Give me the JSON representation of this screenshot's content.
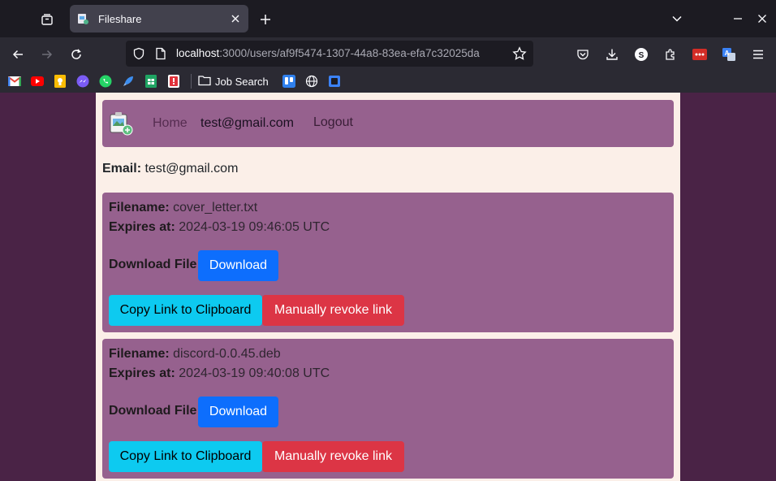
{
  "browser": {
    "tab_title": "Fileshare",
    "url_host": "localhost",
    "url_path": ":3000/users/af9f5474-1307-44a8-83ea-efa7c32025da",
    "bookmark_folder": "Job Search"
  },
  "nav": {
    "home": "Home",
    "user": "test@gmail.com",
    "logout": "Logout"
  },
  "profile": {
    "email_label": "Email:",
    "email_value": "test@gmail.com"
  },
  "labels": {
    "filename": "Filename:",
    "expires": "Expires at:",
    "download_file": "Download File:",
    "download_btn": "Download",
    "copy_btn": "Copy Link to Clipboard",
    "revoke_btn": "Manually revoke link"
  },
  "files": [
    {
      "name": "cover_letter.txt",
      "expires": "2024-03-19 09:46:05 UTC"
    },
    {
      "name": "discord-0.0.45.deb",
      "expires": "2024-03-19 09:40:08 UTC"
    }
  ],
  "colors": {
    "nav_bg": "#96618e",
    "page_bg": "#4a2346",
    "content_bg": "#fbefe8",
    "primary": "#0d6efd",
    "info": "#0dcaf0",
    "danger": "#dc3545"
  }
}
